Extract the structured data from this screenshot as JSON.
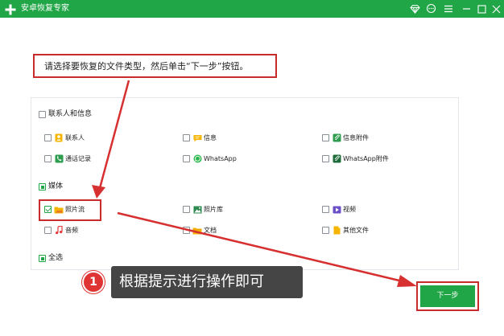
{
  "window": {
    "title": "安卓恢复专家",
    "controls": [
      "vip-diamond-icon",
      "chat-icon",
      "menu-icon",
      "minimize-icon",
      "maximize-icon",
      "close-icon"
    ]
  },
  "instruction": "请选择要恢复的文件类型，然后单击“下一步”按钮。",
  "groups": {
    "contacts": {
      "label": "联系人和信息",
      "state": "unchecked",
      "items": {
        "contacts": {
          "label": "联系人",
          "icon": "contacts-icon",
          "checked": false
        },
        "messages": {
          "label": "信息",
          "icon": "message-icon",
          "checked": false
        },
        "message_attachments": {
          "label": "信息附件",
          "icon": "message-attachment-icon",
          "checked": false
        },
        "call_log": {
          "label": "通话记录",
          "icon": "phone-icon",
          "checked": false
        },
        "whatsapp": {
          "label": "WhatsApp",
          "icon": "whatsapp-icon",
          "checked": false
        },
        "whatsapp_attachments": {
          "label": "WhatsApp附件",
          "icon": "whatsapp-attachment-icon",
          "checked": false
        }
      }
    },
    "media": {
      "label": "媒体",
      "state": "partial",
      "items": {
        "photo_stream": {
          "label": "照片流",
          "icon": "photo-folder-icon",
          "checked": true
        },
        "photo_library": {
          "label": "照片库",
          "icon": "image-icon",
          "checked": false
        },
        "video": {
          "label": "视频",
          "icon": "video-icon",
          "checked": false
        },
        "audio": {
          "label": "音频",
          "icon": "music-icon",
          "checked": false
        },
        "documents": {
          "label": "文档",
          "icon": "folder-icon",
          "checked": false
        },
        "other_files": {
          "label": "其他文件",
          "icon": "file-icon",
          "checked": false
        }
      }
    },
    "select_all": {
      "label": "全选",
      "state": "partial"
    }
  },
  "next_button": "下一步",
  "annotation": {
    "step": "1",
    "text": "根据提示进行操作即可"
  },
  "colors": {
    "brand_green": "#20a647",
    "highlight_red": "#c92a2a",
    "tooltip_bg": "#454545"
  }
}
